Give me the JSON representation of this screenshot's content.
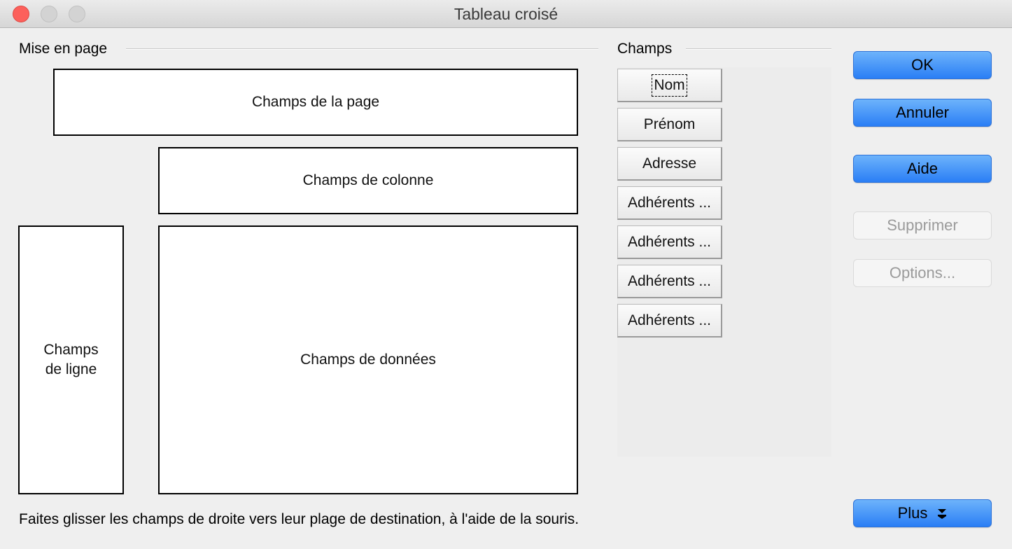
{
  "window": {
    "title": "Tableau croisé"
  },
  "layout_section": {
    "label": "Mise en page",
    "page_fields": "Champs de la page",
    "column_fields": "Champs de colonne",
    "row_fields_line1": "Champs",
    "row_fields_line2": "de ligne",
    "data_fields": "Champs de données"
  },
  "fields_section": {
    "label": "Champs",
    "items": [
      {
        "label": "Nom",
        "focused": true
      },
      {
        "label": "Prénom"
      },
      {
        "label": "Adresse"
      },
      {
        "label": "Adhérents ..."
      },
      {
        "label": "Adhérents ..."
      },
      {
        "label": "Adhérents ..."
      },
      {
        "label": "Adhérents ..."
      }
    ]
  },
  "buttons": {
    "ok": "OK",
    "cancel": "Annuler",
    "help": "Aide",
    "delete": "Supprimer",
    "options": "Options...",
    "more": "Plus"
  },
  "hint": "Faites glisser les champs de droite vers leur plage de destination, à l'aide de la souris.",
  "colors": {
    "accent_blue": "#2a7ef5",
    "close_red": "#fc605b",
    "disabled_text": "#9a9a9a"
  }
}
